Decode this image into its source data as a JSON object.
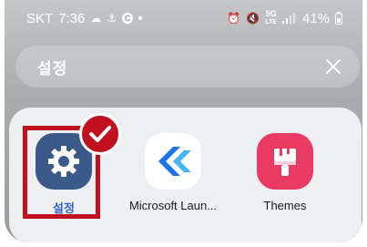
{
  "status_bar": {
    "carrier": "SKT",
    "time": "7:36",
    "battery": "41%",
    "notification_icons": [
      "cloud-icon",
      "android-badge-icon",
      "c-app-icon",
      "dot-icon"
    ],
    "system_icons": [
      "alarm-icon",
      "mute-icon",
      "data-5g-icon",
      "signal-icon",
      "battery-icon"
    ],
    "network_lte": "5G",
    "network_sub": "LTE"
  },
  "search": {
    "query": "설정",
    "clear_icon": "close-icon"
  },
  "results": [
    {
      "label": "설정",
      "icon": "gear-icon",
      "color": "#3b5a8a",
      "selected": true
    },
    {
      "label": "Microsoft Laun...",
      "icon": "microsoft-launcher-icon",
      "color": "#1a73e8"
    },
    {
      "label": "Themes",
      "icon": "paintbrush-icon",
      "color": "#e83a63"
    }
  ],
  "annotation": {
    "highlight_color": "#c3101e",
    "mark_icon": "checkmark-icon"
  }
}
